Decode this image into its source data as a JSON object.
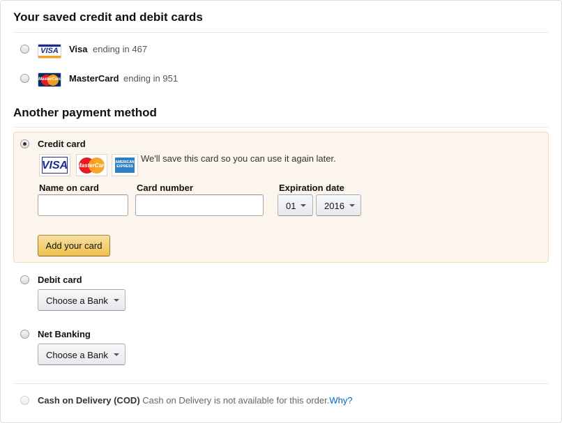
{
  "saved": {
    "heading": "Your saved credit and debit cards",
    "cards": [
      {
        "brand": "Visa",
        "ending": "ending in 467",
        "logo": "visa-logo"
      },
      {
        "brand": "MasterCard",
        "ending": "ending in 951",
        "logo": "mastercard-logo"
      }
    ]
  },
  "another": {
    "heading": "Another payment method",
    "credit": {
      "label": "Credit card",
      "save_note": "We'll save this card so you can use it again later.",
      "logos": [
        "visa-logo",
        "mastercard-logo",
        "amex-logo"
      ],
      "visa_text": "VISA",
      "mc_text": "MasterCard",
      "amex_text": "AMERICAN EXPRESS",
      "name_label": "Name on card",
      "name_value": "",
      "number_label": "Card number",
      "number_value": "",
      "expiry_label": "Expiration date",
      "expiry_month": "01",
      "expiry_year": "2016",
      "add_button": "Add your card"
    },
    "debit": {
      "label": "Debit card",
      "bank_select": "Choose a Bank"
    },
    "netbanking": {
      "label": "Net Banking",
      "bank_select": "Choose a Bank"
    },
    "cod": {
      "label": "Cash on Delivery (COD)",
      "note": "Cash on Delivery is not available for this order.",
      "link": "Why?"
    }
  },
  "colors": {
    "panel_bg": "#fcf5ee",
    "panel_border": "#fbd8b4",
    "button": "#f0c14b",
    "link": "#0066c0"
  }
}
